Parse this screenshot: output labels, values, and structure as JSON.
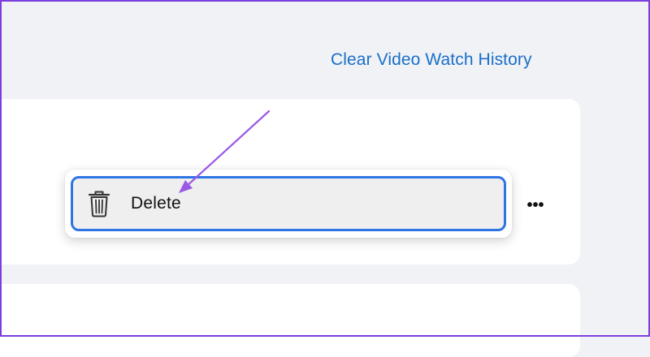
{
  "header": {
    "clear_history_link": "Clear Video Watch History"
  },
  "context_menu": {
    "delete_label": "Delete",
    "delete_icon": "trash-icon"
  },
  "video_item": {
    "more_options_icon": "ellipsis-icon",
    "more_options_glyph": "•••"
  },
  "colors": {
    "link": "#1a6fc9",
    "focus_border": "#2f74e3",
    "annotation_arrow": "#9b59e6",
    "page_background": "#f0f2f5"
  }
}
